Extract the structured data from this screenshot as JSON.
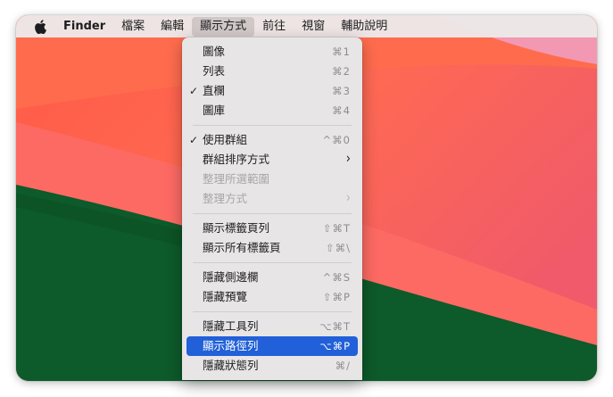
{
  "menubar": {
    "apple_icon": "apple-logo-icon",
    "items": [
      {
        "label": "Finder"
      },
      {
        "label": "檔案"
      },
      {
        "label": "編輯"
      },
      {
        "label": "顯示方式"
      },
      {
        "label": "前往"
      },
      {
        "label": "視窗"
      },
      {
        "label": "輔助說明"
      }
    ]
  },
  "view_menu": {
    "items": [
      {
        "label": "圖像",
        "shortcut": "⌘1"
      },
      {
        "label": "列表",
        "shortcut": "⌘2"
      },
      {
        "label": "直欄",
        "shortcut": "⌘3",
        "checked": true
      },
      {
        "label": "圖庫",
        "shortcut": "⌘4"
      },
      {
        "label": "使用群組",
        "shortcut": "^⌘0",
        "checked": true
      },
      {
        "label": "群組排序方式",
        "submenu": true
      },
      {
        "label": "整理所選範圍",
        "disabled": true
      },
      {
        "label": "整理方式",
        "submenu": true,
        "disabled": true
      },
      {
        "label": "顯示標籤頁列",
        "shortcut": "⇧⌘T"
      },
      {
        "label": "顯示所有標籤頁",
        "shortcut": "⇧⌘\\"
      },
      {
        "label": "隱藏側邊欄",
        "shortcut": "^⌘S"
      },
      {
        "label": "隱藏預覽",
        "shortcut": "⇧⌘P"
      },
      {
        "label": "隱藏工具列",
        "shortcut": "⌥⌘T"
      },
      {
        "label": "顯示路徑列",
        "shortcut": "⌥⌘P",
        "highlighted": true
      },
      {
        "label": "隱藏狀態列",
        "shortcut": "⌘/"
      }
    ],
    "check_glyph": "✓",
    "chevron_glyph": "›"
  },
  "colors": {
    "highlight": "#2160d8",
    "wallpaper_coral": "#f25b4f",
    "wallpaper_green": "#0d5a2a",
    "wallpaper_pink": "#f08aa8"
  }
}
